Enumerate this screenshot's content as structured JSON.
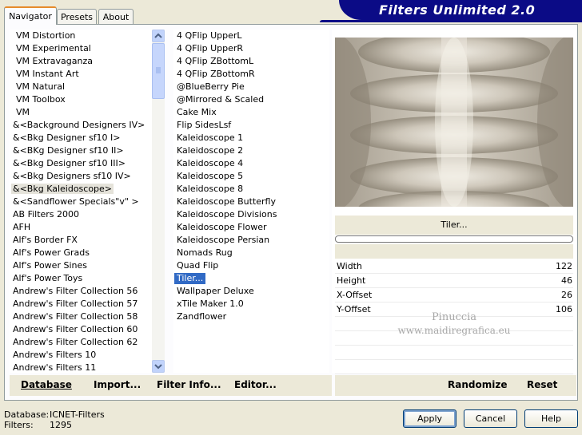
{
  "tabs": [
    {
      "label": "Navigator"
    },
    {
      "label": "Presets"
    },
    {
      "label": "About"
    }
  ],
  "banner": {
    "title": "Filters Unlimited 2.0"
  },
  "categories": [
    "VM Distortion",
    "VM Experimental",
    "VM Extravaganza",
    "VM Instant Art",
    "VM Natural",
    "VM Toolbox",
    "VM",
    "&<Background Designers IV>",
    "&<Bkg Designer sf10 I>",
    "&<BKg Designer sf10 II>",
    "&<Bkg Designer sf10 III>",
    "&<Bkg Designers sf10 IV>",
    "&<Bkg Kaleidoscope>",
    "&<Sandflower Specials\"v\" >",
    "AB Filters 2000",
    "AFH",
    "Alf's Border FX",
    "Alf's Power Grads",
    "Alf's Power Sines",
    "Alf's Power Toys",
    "Andrew's Filter Collection 56",
    "Andrew's Filter Collection 57",
    "Andrew's Filter Collection 58",
    "Andrew's Filter Collection 60",
    "Andrew's Filter Collection 62",
    "Andrew's Filters 10",
    "Andrew's Filters 11"
  ],
  "filters": [
    "4 QFlip UpperL",
    "4 QFlip UpperR",
    "4 QFlip ZBottomL",
    "4 QFlip ZBottomR",
    "@BlueBerry Pie",
    "@Mirrored & Scaled",
    "Cake Mix",
    "Flip SidesLsf",
    "Kaleidoscope 1",
    "Kaleidoscope 2",
    "Kaleidoscope 4",
    "Kaleidoscope 5",
    "Kaleidoscope 8",
    "Kaleidoscope Butterfly",
    "Kaleidoscope Divisions",
    "Kaleidoscope Flower",
    "Kaleidoscope Persian",
    "Nomads Rug",
    "Quad Flip",
    "Tiler...",
    "Wallpaper Deluxe",
    "xTile Maker 1.0",
    "Zandflower"
  ],
  "selected_category_index": 12,
  "selected_filter_index": 19,
  "filter_name": "Tiler...",
  "progress": 0,
  "params": [
    {
      "label": "Width",
      "value": "122"
    },
    {
      "label": "Height",
      "value": "46"
    },
    {
      "label": "X-Offset",
      "value": "26"
    },
    {
      "label": "Y-Offset",
      "value": "106"
    }
  ],
  "watermark": {
    "line1": "Pinuccia",
    "line2": "www.maidiregrafica.eu"
  },
  "toolbar": {
    "database": "Database",
    "import": "Import...",
    "filter_info": "Filter Info...",
    "editor": "Editor...",
    "randomize": "Randomize",
    "reset": "Reset"
  },
  "status": {
    "database_label": "Database:",
    "database_value": "ICNET-Filters",
    "filters_label": "Filters:",
    "filters_value": "1295"
  },
  "buttons": {
    "apply": "Apply",
    "cancel": "Cancel",
    "help": "Help"
  },
  "colors": {
    "banner": "#0b0b86",
    "selection": "#316ac5",
    "tab_accent": "#e68b2c"
  }
}
